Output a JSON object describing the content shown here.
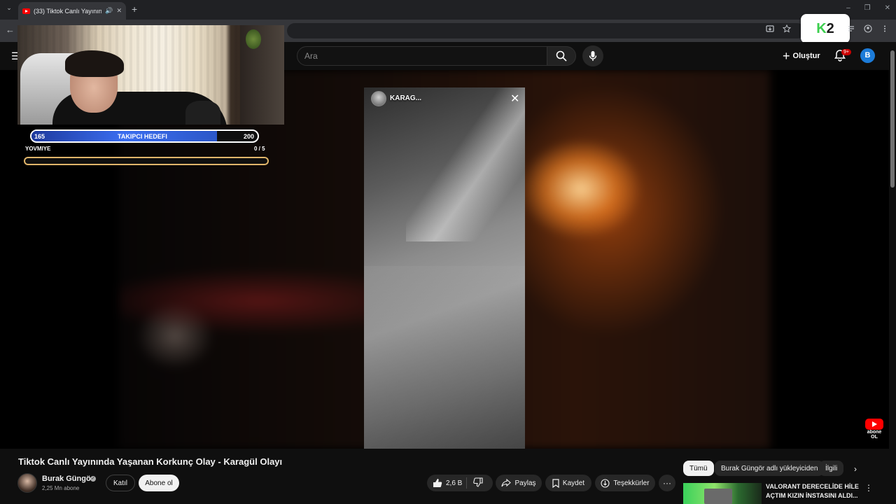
{
  "browser": {
    "tab_title": "(33) Tiktok Canlı Yayınında",
    "tab_close": "✕",
    "tab_audio": "🔊",
    "new_tab": "+",
    "tab_list": "⌄",
    "back": "←",
    "window_controls": [
      "–",
      "❐",
      "✕"
    ],
    "extension_badge": {
      "k": "K",
      "num": "2"
    },
    "toolbar_icons": [
      "install-icon",
      "star-icon",
      "reading-list-icon",
      "profile-icon",
      "more-vert-icon"
    ]
  },
  "youtube_header": {
    "search_placeholder": "Ara",
    "create_label": "Oluştur",
    "notifications_badge": "9+",
    "avatar_initial": "B"
  },
  "player": {
    "story_user": "KARAG...",
    "story_close": "✕",
    "abone_logo_text": "abone\nOL"
  },
  "stream_overlay": {
    "goal_start": "165",
    "goal_label": "TAKIPCI HEDEFI",
    "goal_end": "200",
    "goal_progress": 0.82,
    "daily_label": "YOVMIYE",
    "daily_count": "0 / 5",
    "daily_progress": 0.0
  },
  "video": {
    "title": "Tiktok Canlı Yayınında Yaşanan Korkunç Olay - Karagül Olayı",
    "channel": "Burak Güngör",
    "subscribers": "2,25 Mn abone",
    "join_label": "Katıl",
    "subscribe_label": "Abone ol",
    "likes": "2,6 B",
    "share_label": "Paylaş",
    "save_label": "Kaydet",
    "thanks_label": "Teşekkürler",
    "more_label": "···"
  },
  "related": {
    "chips": [
      "Tümü",
      "Burak Güngör adlı yükleyiciden",
      "İlgili"
    ],
    "next_chip": "›",
    "first_title": "VALORANT DERECELİDE HİLE AÇTIM KIZIN İNSTASINI ALDI...",
    "more": "⋮"
  },
  "colors": {
    "accent_red": "#ff0000",
    "goal_blue": "#3b6ef0",
    "daily_gold": "#e0b56a",
    "avatar_blue": "#1c7bd8"
  }
}
